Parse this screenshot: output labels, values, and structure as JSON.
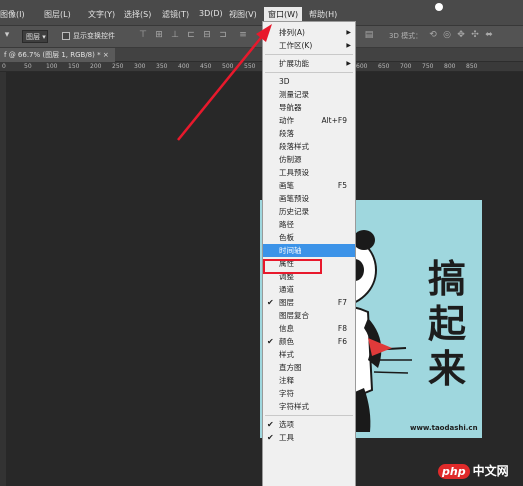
{
  "menubar": {
    "items": [
      "图像(I)",
      "图层(L)",
      "文字(Y)",
      "选择(S)",
      "滤镜(T)",
      "3D(D)",
      "视图(V)",
      "窗口(W)",
      "帮助(H)"
    ],
    "active_index": 7
  },
  "options_bar": {
    "layer_dropdown": "图层",
    "show_transform_label": "显示变换控件",
    "mode_3d_label": "3D 模式："
  },
  "document": {
    "tab_label": "f @ 66.7% (图层 1, RGB/8) * ×"
  },
  "ruler": {
    "labels": [
      "0",
      "50",
      "100",
      "150",
      "200",
      "250",
      "300",
      "350",
      "400",
      "450",
      "500",
      "550",
      "600",
      "650",
      "700",
      "750",
      "800",
      "850"
    ]
  },
  "window_menu": {
    "items": [
      {
        "label": "排列(A)",
        "submenu": true
      },
      {
        "label": "工作区(K)",
        "submenu": true
      },
      {
        "separator": true
      },
      {
        "label": "扩展功能",
        "submenu": true
      },
      {
        "separator": true
      },
      {
        "label": "3D"
      },
      {
        "label": "测量记录"
      },
      {
        "label": "导航器"
      },
      {
        "label": "动作",
        "shortcut": "Alt+F9"
      },
      {
        "label": "段落"
      },
      {
        "label": "段落样式"
      },
      {
        "label": "仿制源"
      },
      {
        "label": "工具预设"
      },
      {
        "label": "画笔",
        "shortcut": "F5"
      },
      {
        "label": "画笔预设"
      },
      {
        "label": "历史记录"
      },
      {
        "label": "路径"
      },
      {
        "label": "色板"
      },
      {
        "label": "时间轴",
        "highlighted": true
      },
      {
        "label": "属性"
      },
      {
        "label": "调整"
      },
      {
        "label": "通道"
      },
      {
        "label": "图层",
        "checked": true,
        "shortcut": "F7"
      },
      {
        "label": "图层复合"
      },
      {
        "label": "信息",
        "shortcut": "F8"
      },
      {
        "label": "颜色",
        "checked": true,
        "shortcut": "F6"
      },
      {
        "label": "样式"
      },
      {
        "label": "直方图"
      },
      {
        "label": "注释"
      },
      {
        "label": "字符"
      },
      {
        "label": "字符样式"
      },
      {
        "separator": true
      },
      {
        "label": "选项",
        "checked": true
      },
      {
        "label": "工具",
        "checked": true
      }
    ]
  },
  "canvas_art": {
    "chars": [
      "搞",
      "起",
      "来"
    ],
    "url": "www.taodashi.cn"
  },
  "watermark": {
    "php": "php",
    "site": "中文网"
  },
  "colors": {
    "menubar_bg": "#4a4a4a",
    "menu_bg": "#f0f0f0",
    "highlight": "#3c93e8",
    "callout_red": "#e8192c",
    "canvas_bg": "#9fd7de"
  }
}
